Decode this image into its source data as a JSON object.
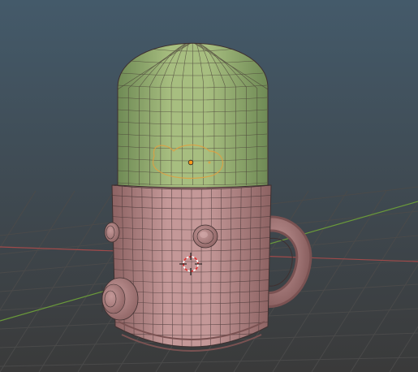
{
  "viewport": {
    "background_top": "#445a6a",
    "background_bottom": "#3a3a3a",
    "grid_color": "#4a4a4a",
    "x_axis_color": "#a04a4a",
    "y_axis_color": "#6a9a3a"
  },
  "object": {
    "body_color": "#c49898",
    "body_shade": "#8c6262",
    "top_color": "#a7be80",
    "top_shade": "#6f8a55",
    "wire_color": "#3f3030",
    "selection_outline_color": "#e0a040",
    "origin_color": "#ff9a1a"
  },
  "icons": {
    "cursor": "3d-cursor-icon",
    "origin": "object-origin-icon"
  }
}
